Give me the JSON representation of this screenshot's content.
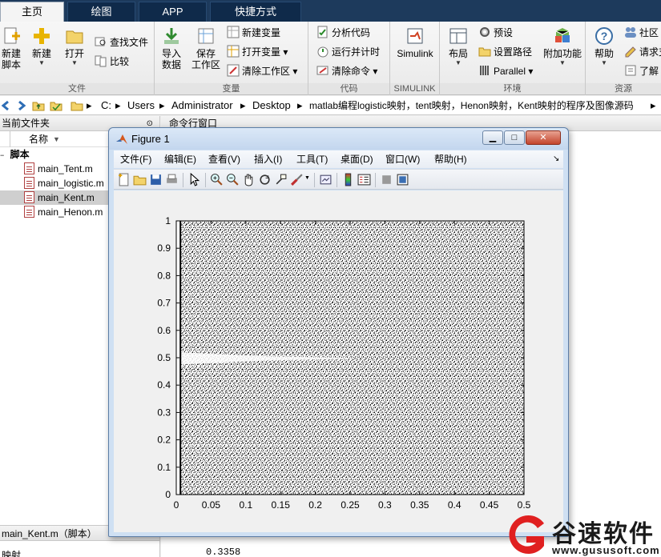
{
  "tabs": [
    {
      "label": "主页",
      "active": true
    },
    {
      "label": "绘图",
      "active": false
    },
    {
      "label": "APP",
      "active": false
    },
    {
      "label": "快捷方式",
      "active": false
    }
  ],
  "ribbon": {
    "file_group": "文件",
    "var_group": "变量",
    "code_group": "代码",
    "simulink_group": "SIMULINK",
    "env_group": "环境",
    "res_group": "资源",
    "new_script": [
      "新建",
      "脚本"
    ],
    "new": "新建",
    "open": "打开",
    "find_files": "查找文件",
    "compare": "比较",
    "import": [
      "导入",
      "数据"
    ],
    "save_ws": [
      "保存",
      "工作区"
    ],
    "new_var": "新建变量",
    "open_var": "打开变量",
    "clear_ws": "清除工作区",
    "analyze_code": "分析代码",
    "run_time": "运行并计时",
    "clear_cmd": "清除命令",
    "simulink": "Simulink",
    "layout": "布局",
    "prefs": "预设",
    "set_path": "设置路径",
    "parallel": "Parallel",
    "addons": "附加功能",
    "help": "帮助",
    "community": "社区",
    "request": "请求支",
    "learn": "了解"
  },
  "address": {
    "segments": [
      "C:",
      "Users",
      "Administrator",
      "Desktop",
      "matlab编程logistic映射，tent映射，Henon映射，Kent映射的程序及图像源码"
    ]
  },
  "left_panel": {
    "title": "当前文件夹",
    "column_name": "名称",
    "folder": "脚本",
    "files": [
      "main_Tent.m",
      "main_logistic.m",
      "main_Kent.m",
      "main_Henon.m"
    ],
    "selected_index": 2,
    "detail_title": "main_Kent.m（脚本）",
    "detail_text": "映射"
  },
  "command_window": {
    "title": "命令行窗口",
    "prompt_text": "0.3358"
  },
  "figure": {
    "title": "Figure 1",
    "menu": [
      "文件(F)",
      "编辑(E)",
      "查看(V)",
      "插入(I)",
      "工具(T)",
      "桌面(D)",
      "窗口(W)",
      "帮助(H)"
    ],
    "colors": {
      "title_bg": "#c3d6ee",
      "close": "#c3442c"
    }
  },
  "chart_data": {
    "type": "scatter",
    "title": "",
    "xlabel": "",
    "ylabel": "",
    "xlim": [
      0,
      0.5
    ],
    "ylim": [
      0,
      1
    ],
    "xticks": [
      "0",
      "0.05",
      "0.1",
      "0.15",
      "0.2",
      "0.25",
      "0.3",
      "0.35",
      "0.4",
      "0.45",
      "0.5"
    ],
    "yticks": [
      "0",
      "0.1",
      "0.2",
      "0.3",
      "0.4",
      "0.5",
      "0.6",
      "0.7",
      "0.8",
      "0.9",
      "1"
    ],
    "description_series": [
      {
        "name": "",
        "x_range": [
          0,
          0.5
        ],
        "y_range": [
          0,
          1
        ],
        "marker_color": "#000000"
      }
    ],
    "grid": false
  },
  "watermark": {
    "brand": "谷速软件",
    "url": "www.gususoft.com"
  }
}
